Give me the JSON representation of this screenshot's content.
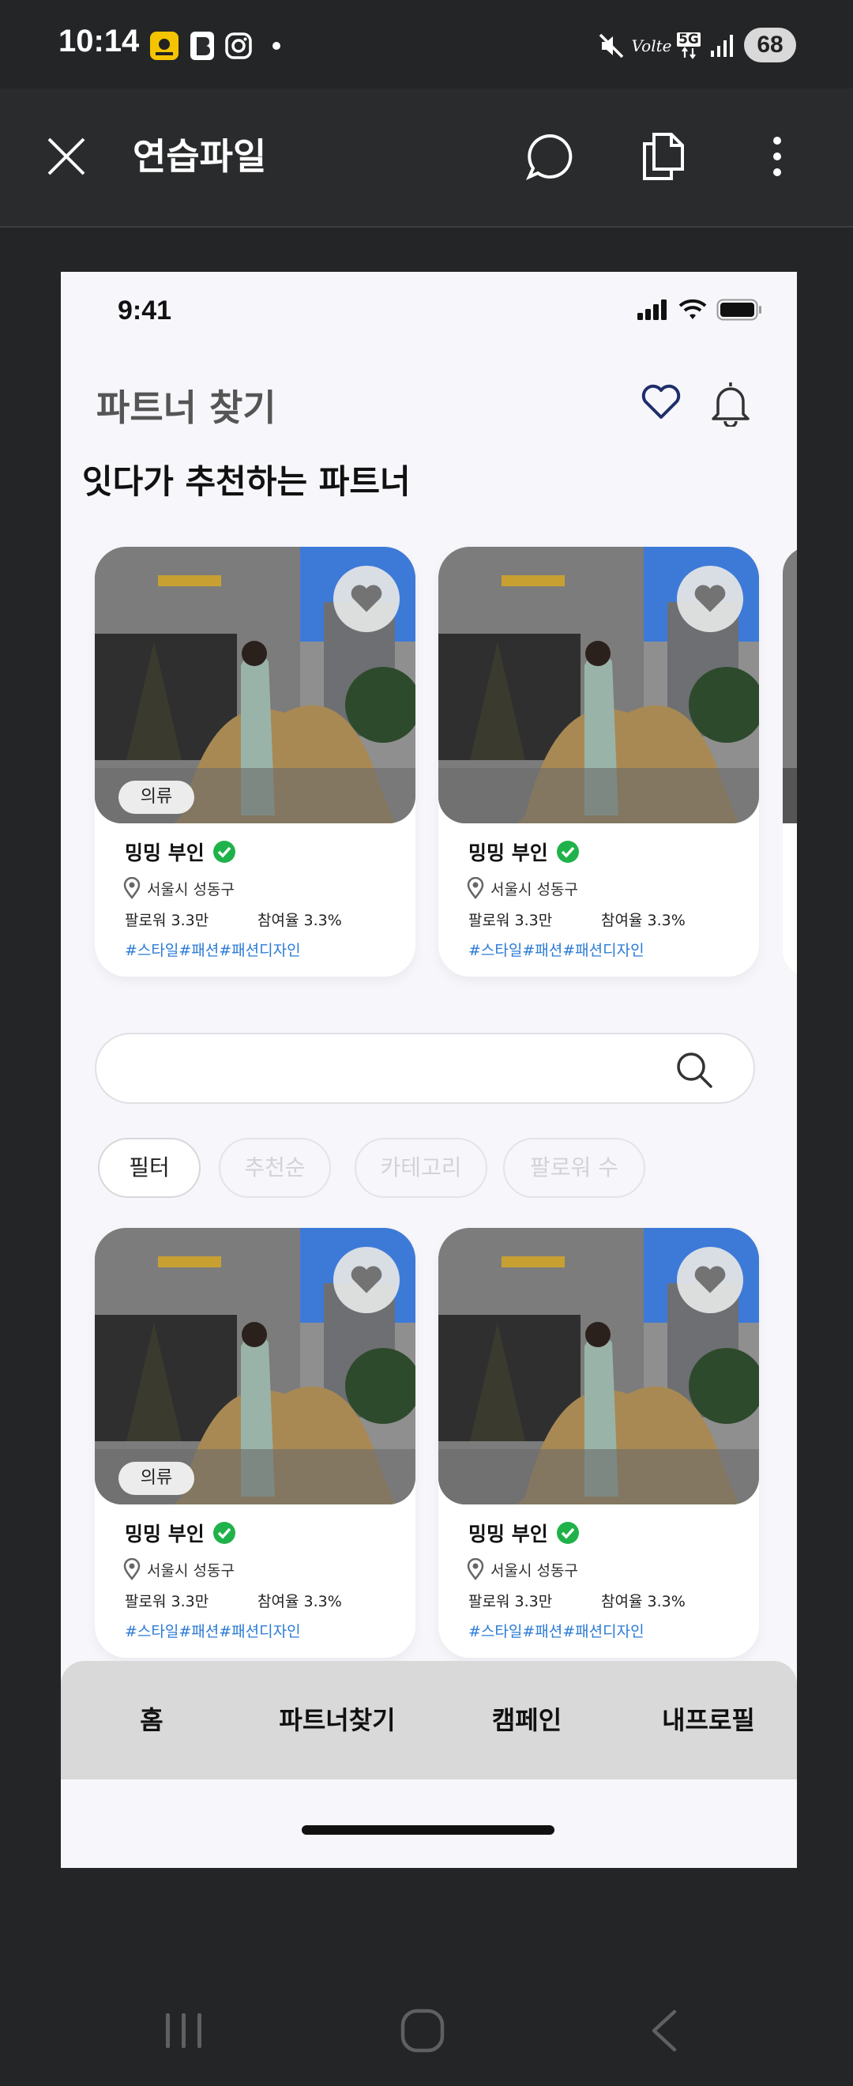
{
  "android_status": {
    "time": "10:14",
    "battery": "68",
    "network_label": "5G",
    "volte_label": "Volte"
  },
  "toolbar": {
    "title": "연습파일"
  },
  "ios_status": {
    "time": "9:41"
  },
  "page": {
    "title": "파트너 찾기",
    "section_title": "잇다가 추천하는 파트너"
  },
  "recommended_cards": [
    {
      "category": "의류",
      "name": "밍밍 부인",
      "location": "서울시 성동구",
      "followers": "팔로워 3.3만",
      "engagement": "참여율 3.3%",
      "tags": "#스타일#패션#패션디자인"
    },
    {
      "category": "",
      "name": "밍밍 부인",
      "location": "서울시 성동구",
      "followers": "팔로워 3.3만",
      "engagement": "참여율 3.3%",
      "tags": "#스타일#패션#패션디자인"
    }
  ],
  "search": {
    "placeholder": "",
    "value": ""
  },
  "filter_chips": [
    {
      "label": "필터",
      "active": true
    },
    {
      "label": "추천순",
      "active": false
    },
    {
      "label": "카테고리",
      "active": false
    },
    {
      "label": "팔로워 수",
      "active": false
    }
  ],
  "grid_cards": [
    {
      "category": "의류",
      "name": "밍밍 부인",
      "location": "서울시 성동구",
      "followers": "팔로워 3.3만",
      "engagement": "참여율 3.3%",
      "tags": "#스타일#패션#패션디자인"
    },
    {
      "category": "",
      "name": "밍밍 부인",
      "location": "서울시 성동구",
      "followers": "팔로워 3.3만",
      "engagement": "참여율 3.3%",
      "tags": "#스타일#패션#패션디자인"
    }
  ],
  "bottom_nav": [
    "홈",
    "파트너찾기",
    "캠페인",
    "내프로필"
  ],
  "colors": {
    "verified": "#20b24a",
    "tag_link": "#2b7bd6",
    "heart_outline": "#1f2e6b"
  }
}
